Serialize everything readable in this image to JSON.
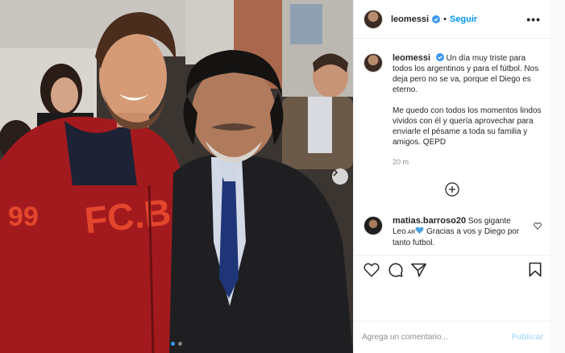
{
  "post": {
    "username": "leomessi",
    "separator": "•",
    "follow_label": "Seguir",
    "more_label": "•••",
    "caption_paragraph_1": "Un día muy triste para todos los argentinos y para el fútbol. Nos deja pero no se va, porque el Diego es eterno.",
    "caption_paragraph_2": "Me quedo con todos los momentos lindos vividos con él y quería aprovechar para enviarle el pésame a toda su familia y amigos. QEPD",
    "time_ago": "20 m",
    "jersey_text": "FC.B",
    "jersey_number": "99"
  },
  "comment": {
    "username": "matias.barroso20",
    "text_before": "Sos gigante Leo",
    "flag_text": ".AR",
    "text_after": " Gracias a vos y Diego por tanto futbol."
  },
  "composer": {
    "placeholder": "Agrega un comentario...",
    "publish_label": "Publicar"
  },
  "colors": {
    "accent": "#0095f6",
    "verified": "#3897f0",
    "publish_disabled": "#b2dffc",
    "muted_text": "#8e8e8e"
  },
  "icons": [
    "verified-badge-icon",
    "more-options-icon",
    "chevron-right-icon",
    "plus-circle-icon",
    "heart-icon",
    "comment-icon",
    "share-icon",
    "bookmark-icon",
    "blue-heart-icon"
  ]
}
